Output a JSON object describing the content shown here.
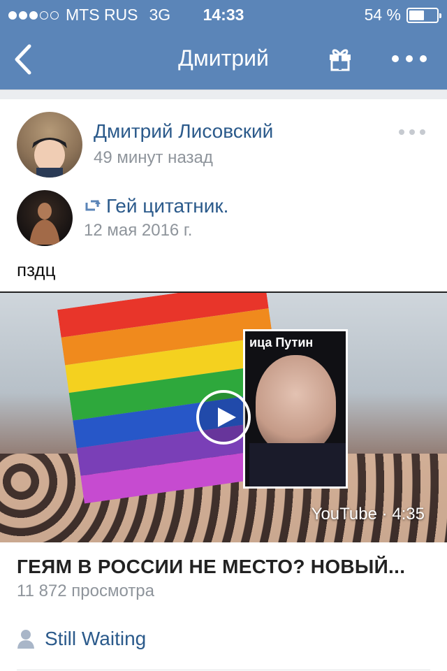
{
  "statusbar": {
    "carrier": "MTS RUS",
    "network": "3G",
    "time": "14:33",
    "battery_text": "54 %",
    "battery_level": 0.54,
    "signal_filled": 3,
    "signal_total": 5
  },
  "nav": {
    "title": "Дмитрий",
    "back_icon": "chevron-left-icon",
    "gift_icon": "gift-icon",
    "more_icon": "more-icon"
  },
  "post": {
    "author_name": "Дмитрий Лисовский",
    "time_ago": "49 минут назад",
    "repost": {
      "group_name": "Гей цитатник.",
      "date": "12 мая 2016 г."
    },
    "text": "пздц",
    "video": {
      "poster_caption": "ица Путин",
      "source_label": "YouTube · 4:35",
      "title": "ГЕЯМ В РОССИИ НЕ МЕСТО? НОВЫЙ...",
      "views": "11 872 просмотра"
    }
  },
  "status": {
    "text": "Still Waiting"
  },
  "colors": {
    "header": "#5b85b8",
    "link": "#2b5a8b",
    "muted": "#8e949b"
  }
}
